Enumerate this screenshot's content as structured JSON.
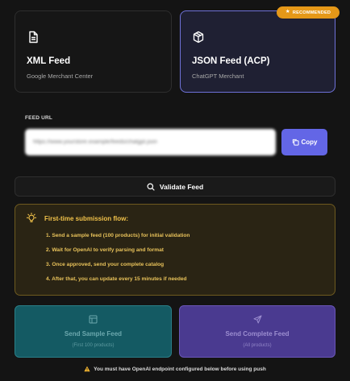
{
  "feed_options": [
    {
      "title": "XML Feed",
      "subtitle": "Google Merchant Center",
      "icon": "document-icon"
    },
    {
      "title": "JSON Feed (ACP)",
      "subtitle": "ChatGPT Merchant",
      "icon": "box-icon",
      "selected": true
    }
  ],
  "badge": {
    "label": "RECOMMENDED",
    "icon": "star-icon",
    "color": "#e59818"
  },
  "feed_url": {
    "label": "FEED URL",
    "value": "https://www.yourstore.example/feeds/chatgpt.json"
  },
  "copy_button": {
    "label": "Copy",
    "color": "#6366e6"
  },
  "validate_button": {
    "label": "Validate Feed",
    "icon": "search-icon"
  },
  "notice": {
    "title": "First-time submission flow:",
    "icon": "lightbulb-icon",
    "steps": [
      "1. Send a sample feed (100 products) for initial validation",
      "2. Wait for OpenAI to verify parsing and format",
      "3. Once approved, send your complete catalog",
      "4. After that, you can update every 15 minutes if needed"
    ]
  },
  "send_sample": {
    "title": "Send Sample Feed",
    "subtitle": "(First 100 products)",
    "icon": "table-icon",
    "color": "#145a63"
  },
  "send_complete": {
    "title": "Send Complete Feed",
    "subtitle": "(All products)",
    "icon": "send-icon",
    "color": "#4a3a90"
  },
  "footer_warning": {
    "text": "You must have OpenAI endpoint configured below before using push",
    "icon": "warning-icon"
  }
}
